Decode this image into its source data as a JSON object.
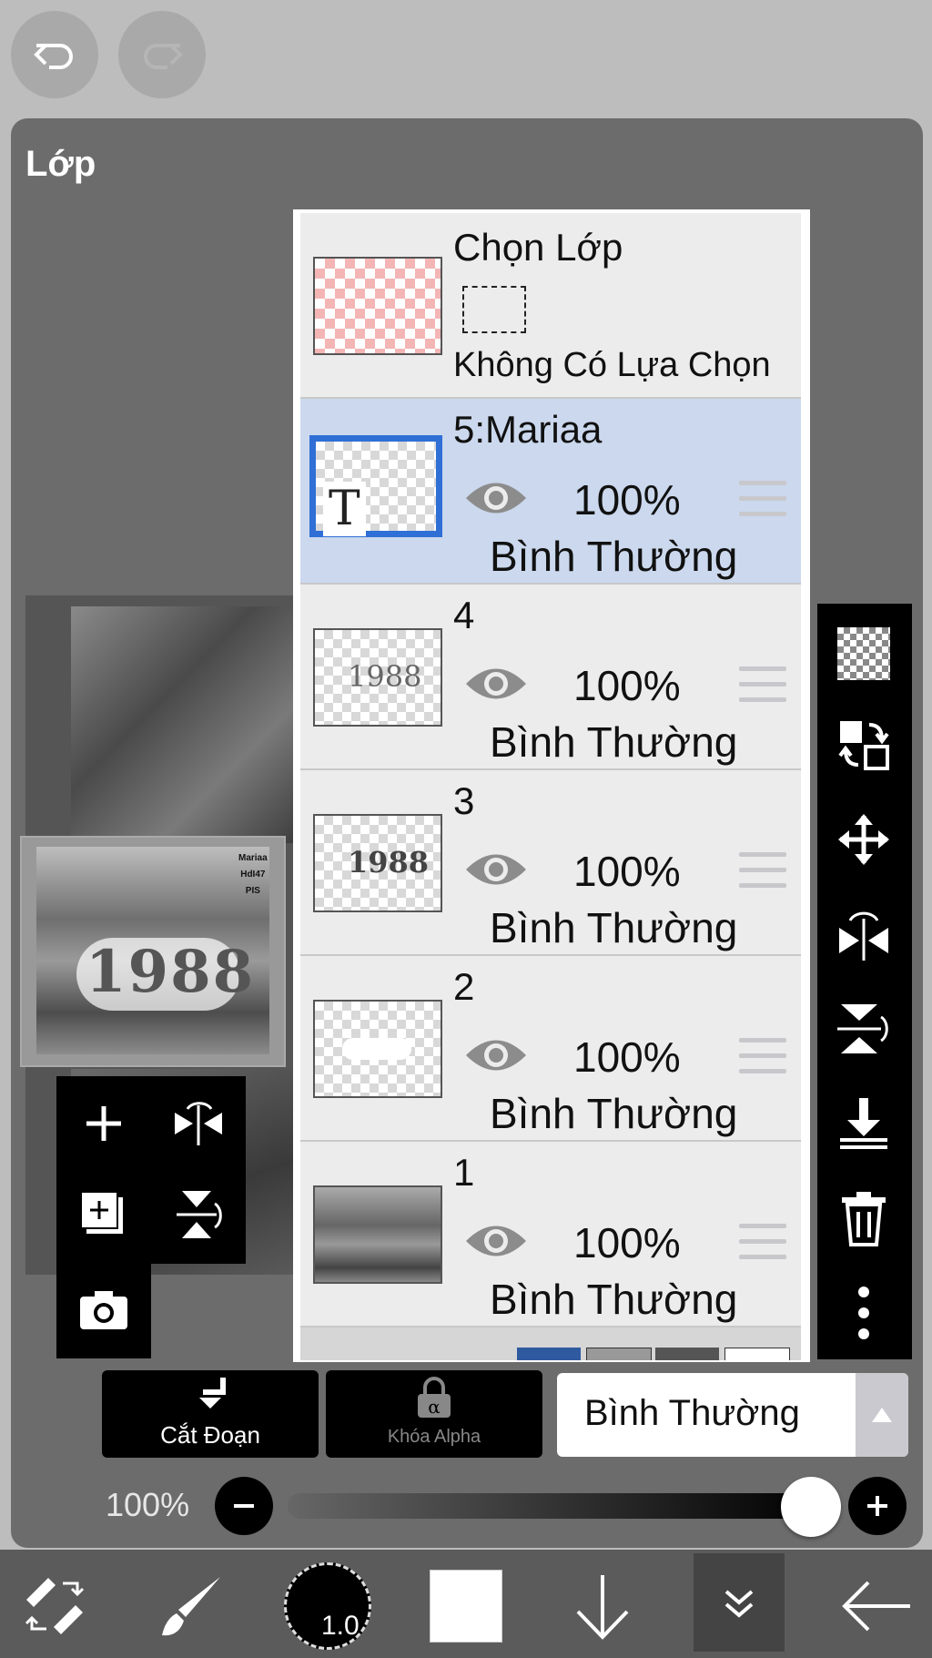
{
  "top": {
    "undo_icon": "undo-icon",
    "redo_icon": "redo-icon"
  },
  "panel": {
    "title": "Lớp"
  },
  "select_layer": {
    "title": "Chọn Lớp",
    "status": "Không Có Lựa Chọn"
  },
  "layers": [
    {
      "name": "5:Mariaa",
      "opacity": "100%",
      "blend": "Bình Thường",
      "selected": true,
      "kind": "text"
    },
    {
      "name": "4",
      "opacity": "100%",
      "blend": "Bình Thường",
      "selected": false,
      "thumb_text": "1988"
    },
    {
      "name": "3",
      "opacity": "100%",
      "blend": "Bình Thường",
      "selected": false,
      "thumb_text": "1988"
    },
    {
      "name": "2",
      "opacity": "100%",
      "blend": "Bình Thường",
      "selected": false
    },
    {
      "name": "1",
      "opacity": "100%",
      "blend": "Bình Thường",
      "selected": false
    }
  ],
  "text_layer_glyph": "T",
  "preview": {
    "title_text": "1988",
    "corner_lines": [
      "Mariaa",
      "HdI47",
      "PIS"
    ]
  },
  "bottom": {
    "clip_label": "Cắt Đoạn",
    "alpha_lock_label": "Khóa Alpha",
    "blend_mode": "Bình Thường",
    "opacity_label": "100%",
    "opacity_value": 1.0
  },
  "toolbar": {
    "brush_size": "1.0"
  },
  "colors": {
    "selected_row": "#cbd8ed",
    "selected_border": "#2f6fd6",
    "panel_bg": "#6c6c6c"
  }
}
